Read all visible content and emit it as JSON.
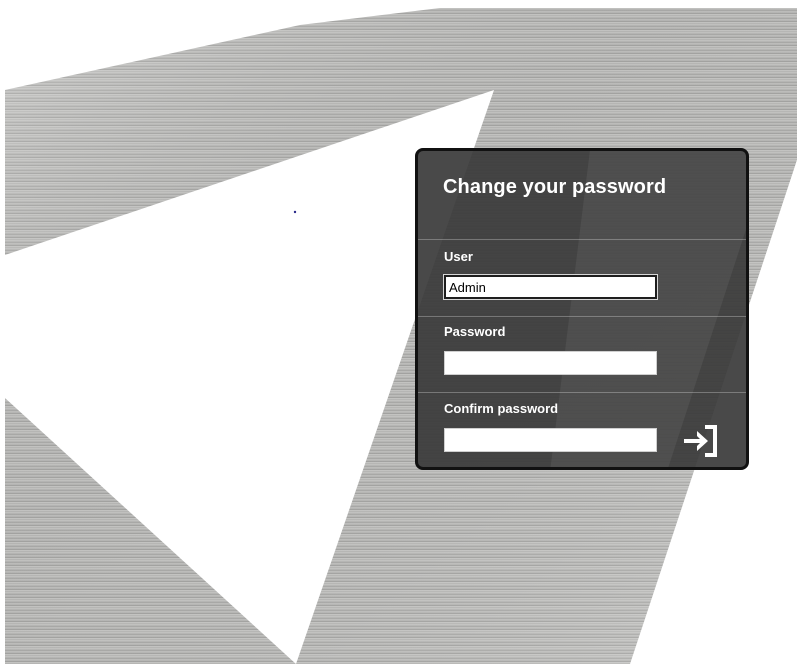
{
  "form": {
    "title": "Change your password",
    "user_label": "User",
    "user_value": "Admin",
    "password_label": "Password",
    "password_value": "",
    "confirm_label": "Confirm password",
    "confirm_value": "",
    "submit_icon": "sign-in-arrow-icon"
  },
  "colors": {
    "panel_background": "#3a3a3a",
    "panel_border": "#111111",
    "text": "#ffffff",
    "input_background": "#ffffff"
  },
  "background": {
    "style": "brushed-metal-triangles",
    "metal_color": "#b8b8b6",
    "cutout_color": "#ffffff"
  }
}
